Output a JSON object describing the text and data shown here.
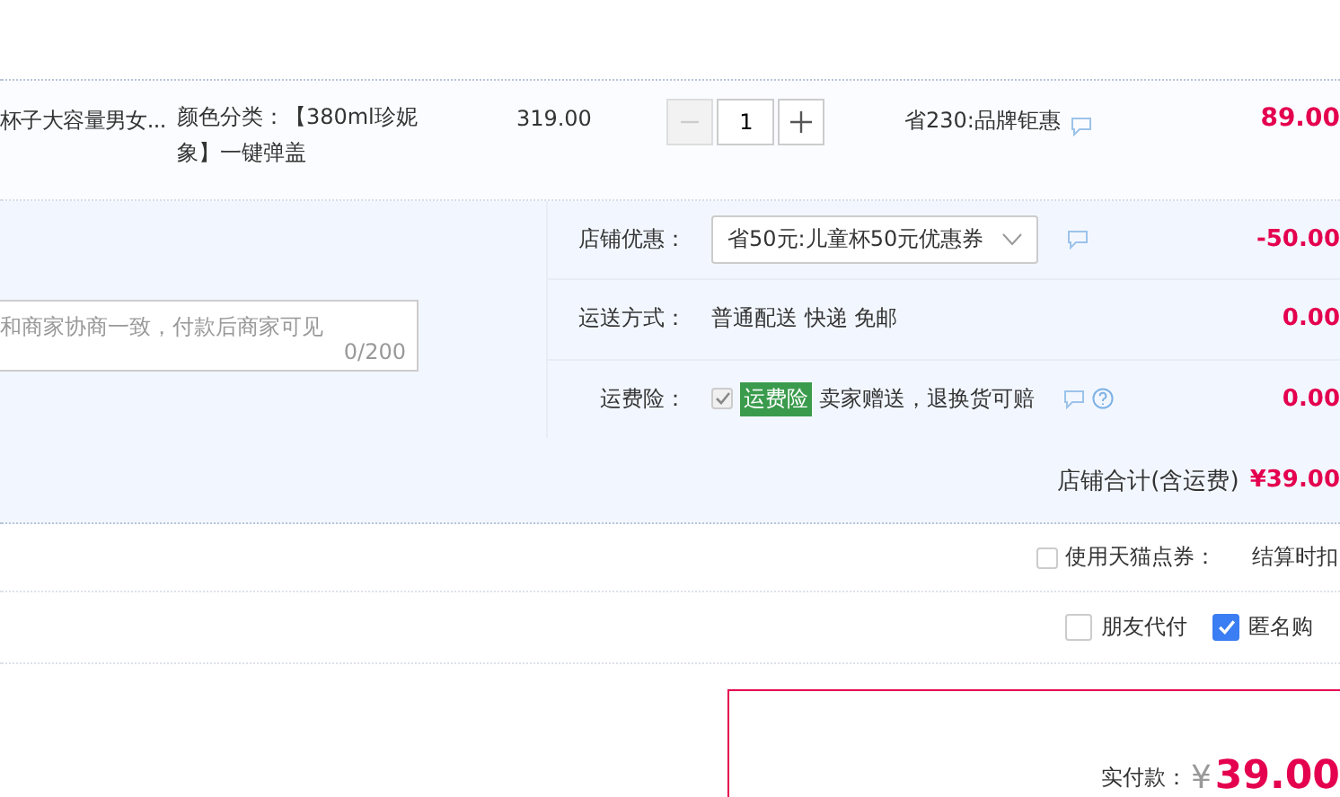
{
  "item": {
    "name": "杯子大容量男女...",
    "sku": "颜色分类：【380ml珍妮象】一键弹盖",
    "price": "319.00",
    "quantity": {
      "value": "1",
      "decrease_disabled": true
    },
    "promotion": "省230:品牌钜惠",
    "amount": "89.00"
  },
  "message": {
    "placeholder": "和商家协商一致，付款后商家可见",
    "count": "0/200"
  },
  "options": [
    {
      "kind": "select",
      "label": "店铺优惠：",
      "value": "省50元:儿童杯50元优惠券",
      "amount": "-50.00"
    },
    {
      "kind": "text",
      "label": "运送方式：",
      "value": "普通配送 快递 免邮",
      "amount": "0.00"
    },
    {
      "kind": "insurance",
      "label": "运费险：",
      "checked": true,
      "disabled": true,
      "tag": "运费险",
      "value": "卖家赠送，退换货可赔",
      "amount": "0.00"
    }
  ],
  "store_total": {
    "label": "店铺合计(含运费)",
    "value": "¥39.00"
  },
  "points": {
    "checked": false,
    "label": "使用天猫点券：",
    "note": "结算时扣"
  },
  "pay_options": [
    {
      "label": "朋友代付",
      "checked": false
    },
    {
      "label": "匿名购",
      "checked": true
    }
  ],
  "payment": {
    "label": "实付款：",
    "currency": "¥",
    "value": "39.00"
  }
}
